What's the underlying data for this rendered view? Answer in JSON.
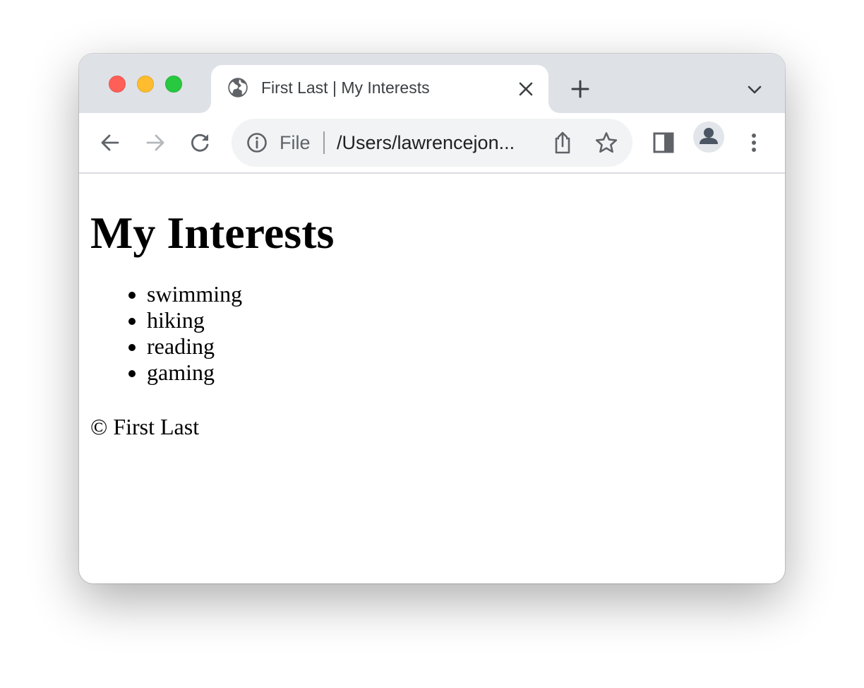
{
  "window": {
    "controls": [
      "close",
      "minimize",
      "maximize"
    ]
  },
  "tab": {
    "title": "First Last | My Interests",
    "favicon": "globe-icon"
  },
  "toolbar": {
    "back_icon": "arrow-left-icon",
    "forward_icon": "arrow-right-icon",
    "reload_icon": "reload-icon",
    "side_panel_icon": "side-panel-icon",
    "profile_icon": "person-icon",
    "menu_icon": "kebab-menu-icon"
  },
  "omnibox": {
    "scheme_label": "File",
    "url": "/Users/lawrencejon..."
  },
  "page": {
    "heading": "My Interests",
    "interests": [
      "swimming",
      "hiking",
      "reading",
      "gaming"
    ],
    "footer": "© First Last"
  },
  "colors": {
    "tabstrip_bg": "#dee1e6",
    "omnibox_bg": "#f1f3f4",
    "traffic_red": "#ff5f57",
    "traffic_yellow": "#febc2e",
    "traffic_green": "#28c840",
    "icon_gray": "#5f6368"
  }
}
